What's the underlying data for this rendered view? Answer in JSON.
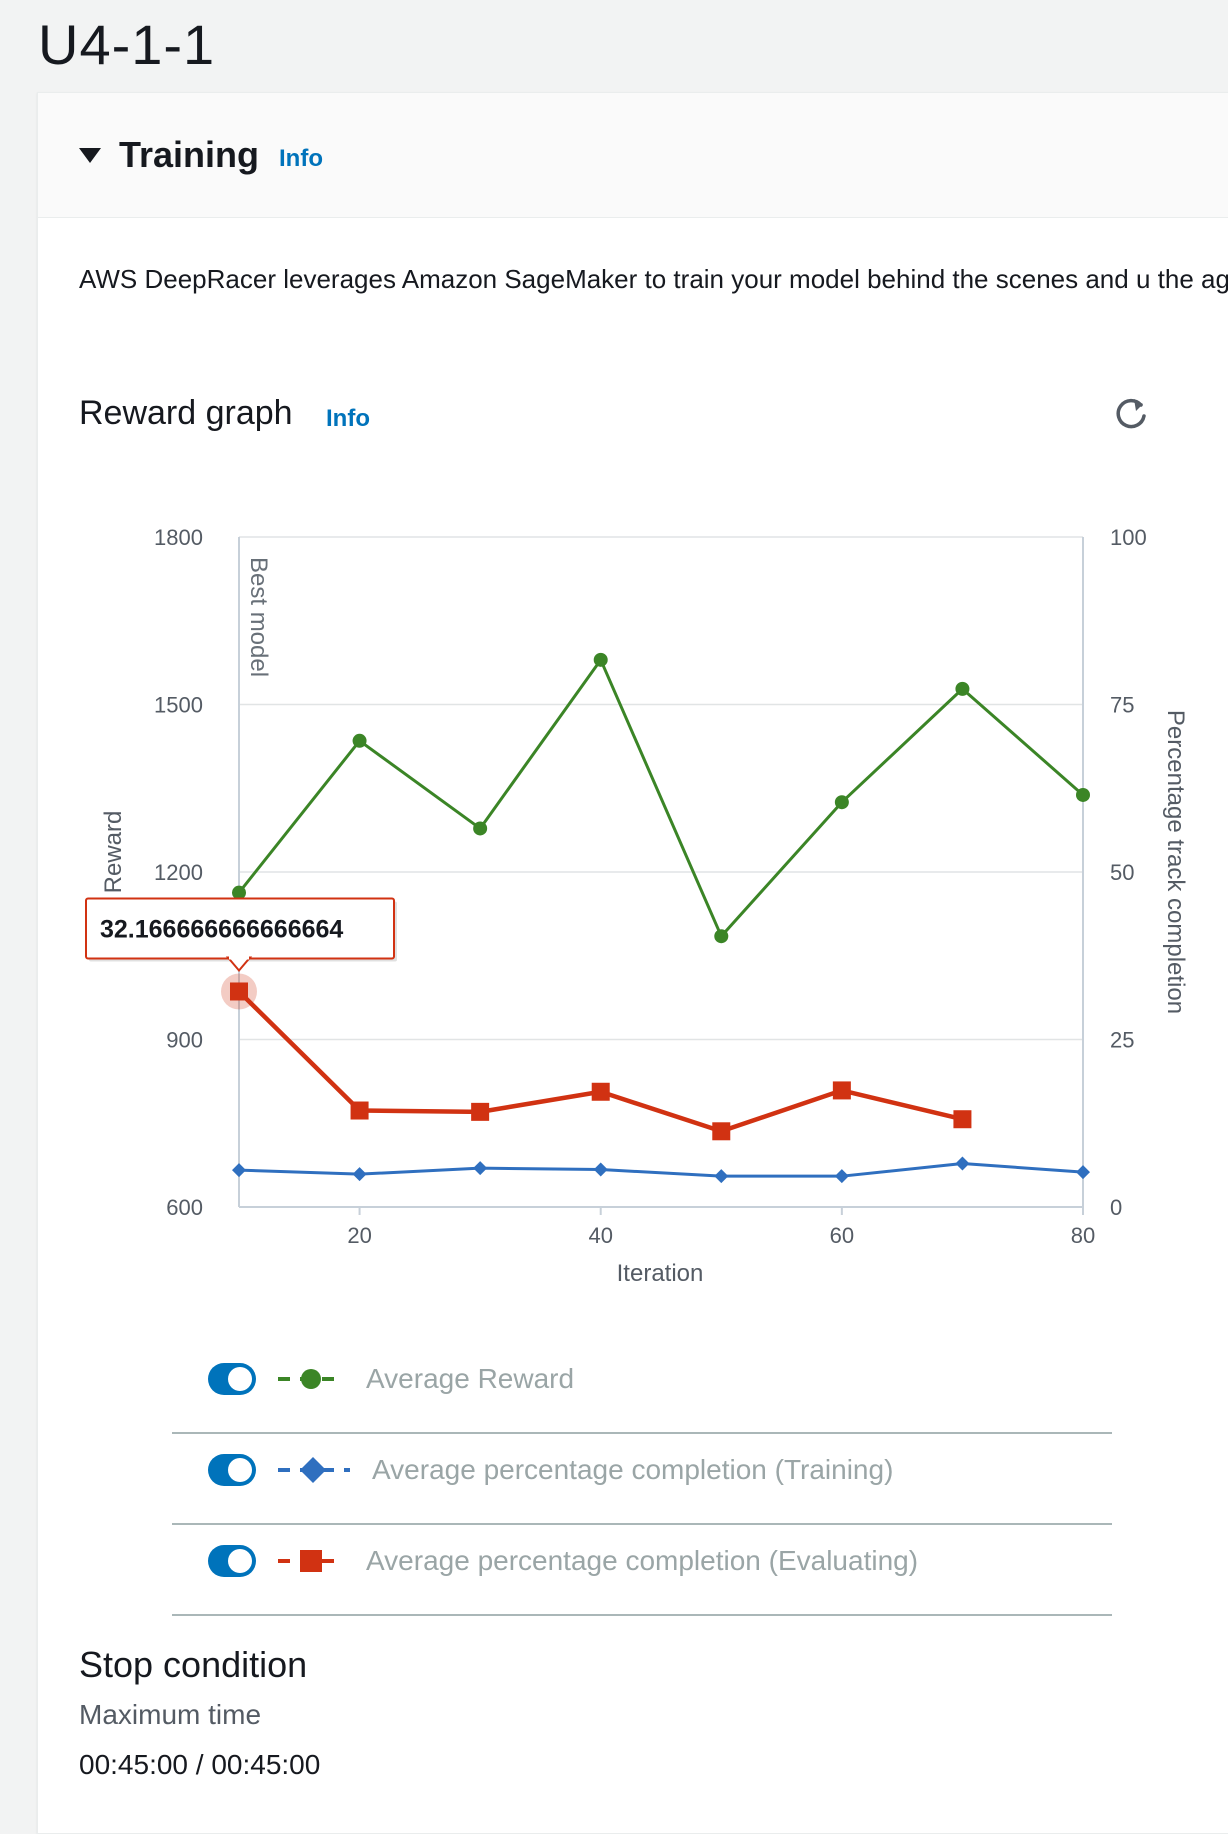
{
  "page": {
    "title": "U4-1-1"
  },
  "training": {
    "title": "Training",
    "info": "Info",
    "description": "AWS DeepRacer leverages Amazon SageMaker to train your model behind the scenes and u the agent behaves in the chosen environment, as prescribed by the reward function."
  },
  "reward_graph": {
    "title": "Reward graph",
    "info": "Info",
    "refresh_icon": "refresh-icon",
    "tooltip": "32.166666666666664"
  },
  "chart_data": {
    "type": "line",
    "xlabel": "Iteration",
    "ylabel_left": "Reward",
    "ylabel_right": "Percentage track completion",
    "xlim": [
      10,
      80
    ],
    "ylim_left": [
      600,
      1800
    ],
    "ylim_right": [
      0,
      100
    ],
    "x_ticks": [
      20,
      40,
      60,
      80
    ],
    "y_left_ticks": [
      600,
      900,
      1200,
      1500,
      1800
    ],
    "y_right_ticks": [
      0,
      25,
      50,
      75,
      100
    ],
    "grid": true,
    "annotation": "Best model",
    "series": [
      {
        "name": "Average Reward",
        "axis": "left",
        "color": "#3b8526",
        "marker": "circle",
        "x": [
          10,
          20,
          30,
          40,
          50,
          60,
          70,
          80
        ],
        "values": [
          1163,
          1435,
          1278,
          1580,
          1085,
          1325,
          1528,
          1338
        ]
      },
      {
        "name": "Average percentage completion (Training)",
        "axis": "right",
        "color": "#2f6fbf",
        "marker": "diamond",
        "x": [
          10,
          20,
          30,
          40,
          50,
          60,
          70,
          80
        ],
        "values": [
          5.5,
          4.9,
          5.8,
          5.6,
          4.6,
          4.6,
          6.5,
          5.2
        ]
      },
      {
        "name": "Average percentage completion (Evaluating)",
        "axis": "right",
        "color": "#d13212",
        "marker": "square",
        "x": [
          10,
          20,
          30,
          40,
          50,
          60,
          70
        ],
        "values": [
          32.166666666666664,
          14.4,
          14.2,
          17.2,
          11.3,
          17.4,
          13.1
        ]
      }
    ]
  },
  "legend": [
    {
      "label": "Average Reward",
      "enabled": true
    },
    {
      "label": "Average percentage completion (Training)",
      "enabled": true
    },
    {
      "label": "Average percentage completion (Evaluating)",
      "enabled": true
    }
  ],
  "stop_condition": {
    "title": "Stop condition",
    "label": "Maximum time",
    "value": "00:45:00 / 00:45:00"
  }
}
